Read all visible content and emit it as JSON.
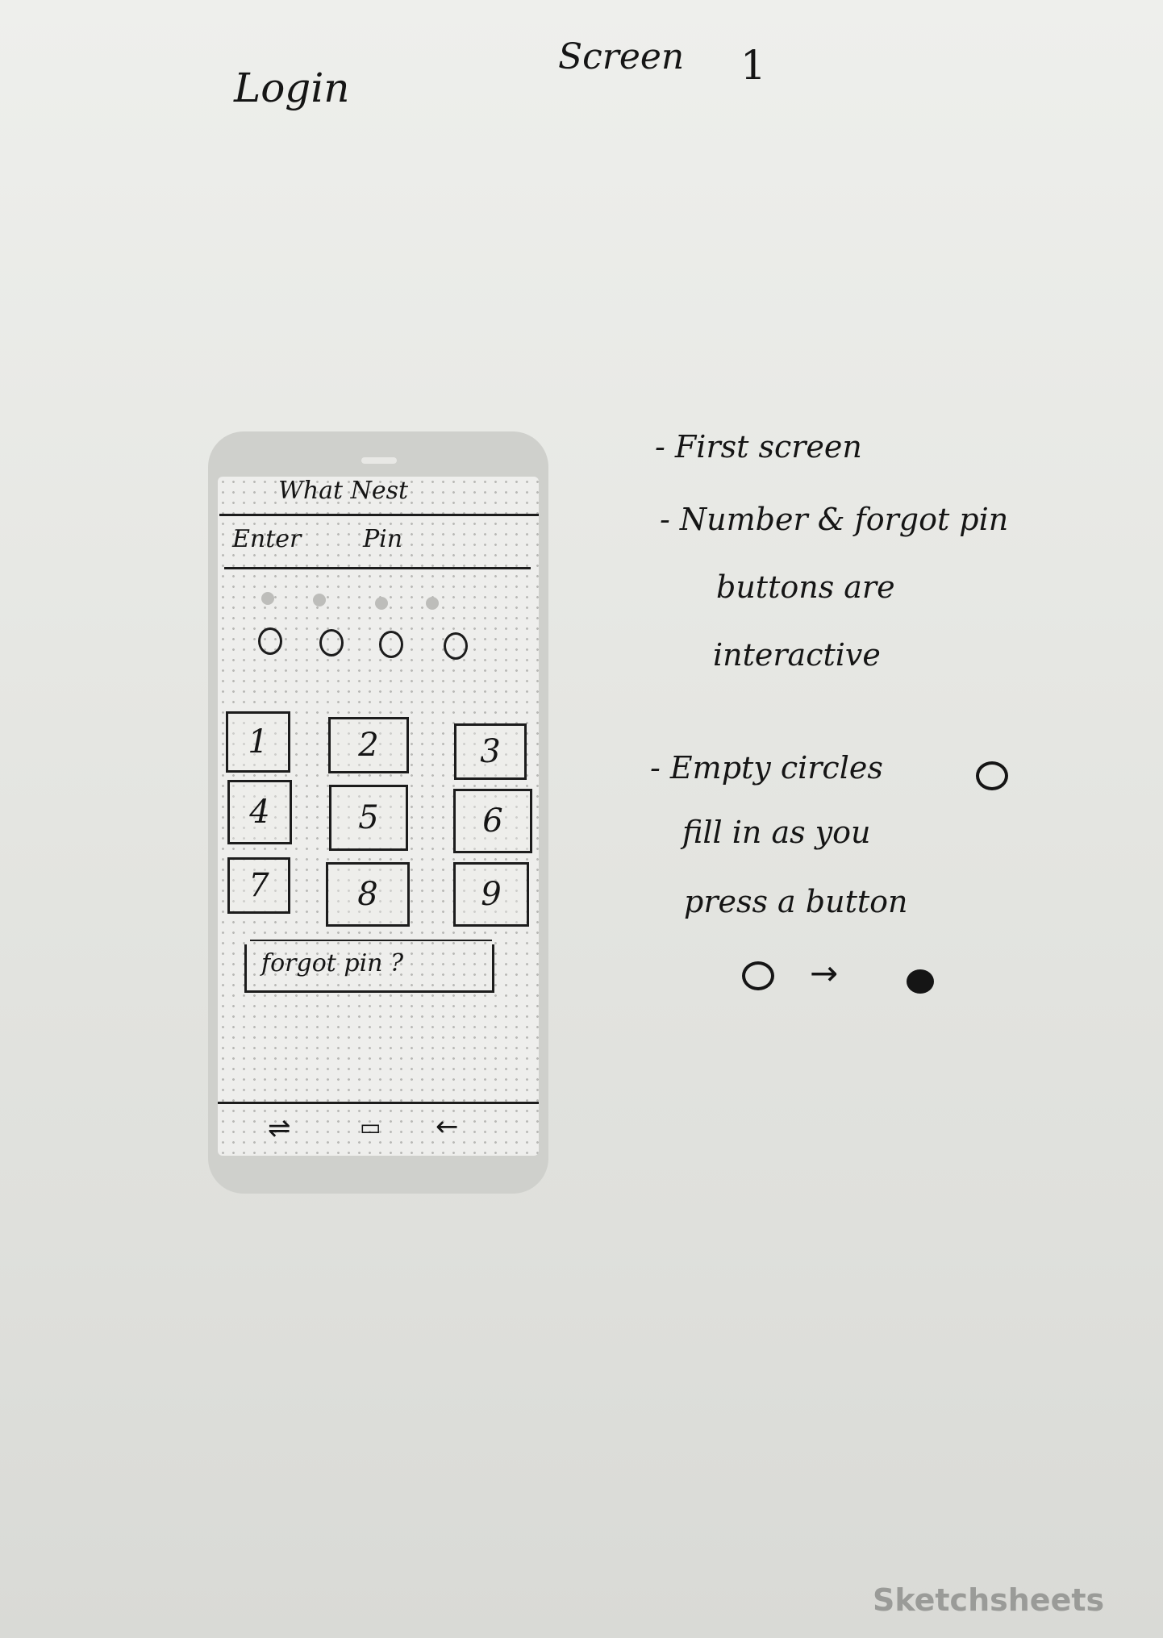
{
  "header": {
    "page_label": "Login",
    "screen_label": "Screen",
    "screen_number": "1"
  },
  "phone": {
    "app_title": "What Nest",
    "enter_label": "Enter",
    "pin_label": "Pin",
    "pin_slots": 4,
    "keypad": [
      "1",
      "2",
      "3",
      "4",
      "5",
      "6",
      "7",
      "8",
      "9"
    ],
    "forgot_button": "forgot pin ?",
    "nav_icons": [
      "recent-apps-icon",
      "home-icon",
      "back-icon"
    ]
  },
  "notes": {
    "line1": "- First screen",
    "line2": "- Number & forgot pin",
    "line3": "buttons are",
    "line4": "interactive",
    "line5": "- Empty circles",
    "line6": "fill in as you",
    "line7": "press a button"
  },
  "brand": "Sketchsheets"
}
